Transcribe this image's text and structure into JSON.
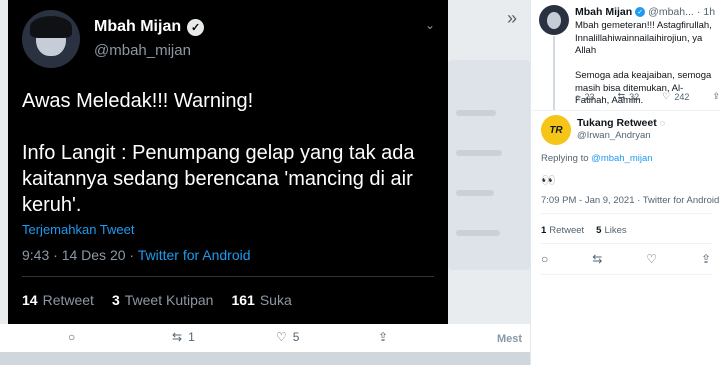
{
  "main_tweet": {
    "display_name": "Mbah Mijan",
    "handle": "@mbah_mijan",
    "text": "Awas Meledak!!! Warning!\n\nInfo Langit : Penumpang gelap yang tak ada kaitannya sedang berencana 'mancing di air keruh'.",
    "translate_label": "Terjemahkan Tweet",
    "time": "9:43 · 14 Des 20 · ",
    "source": "Twitter for Android",
    "stats": {
      "retweets": "14",
      "retweets_label": "Retweet",
      "quotes": "3",
      "quotes_label": "Tweet Kutipan",
      "likes": "161",
      "likes_label": "Suka"
    }
  },
  "bottom_bar": {
    "retweet_count": "1",
    "like_count": "5"
  },
  "background": {
    "section_label": "Mest"
  },
  "right_panel": {
    "parent": {
      "display_name": "Mbah Mijan",
      "handle_short": "@mbah...",
      "age": "1h",
      "text": "Mbah gemeteran!!! Astagfirullah, Innalillahiwainnailaihirojiun, ya Allah\n\nSemoga ada keajaiban, semoga masih bisa ditemukan, Al-Fatihah, Aamiin.",
      "replies": "23",
      "retweets": "32",
      "likes": "242"
    },
    "reply": {
      "avatar_text": "TR",
      "display_name": "Tukang Retweet",
      "handle": "@Irwan_Andryan",
      "replying_label": "Replying to",
      "replying_to": "@mbah_mijan",
      "text": "👀",
      "time": "7:09 PM - Jan 9, 2021 · Twitter for Android",
      "retweets": "1",
      "retweets_label": "Retweet",
      "likes": "5",
      "likes_label": "Likes"
    }
  }
}
